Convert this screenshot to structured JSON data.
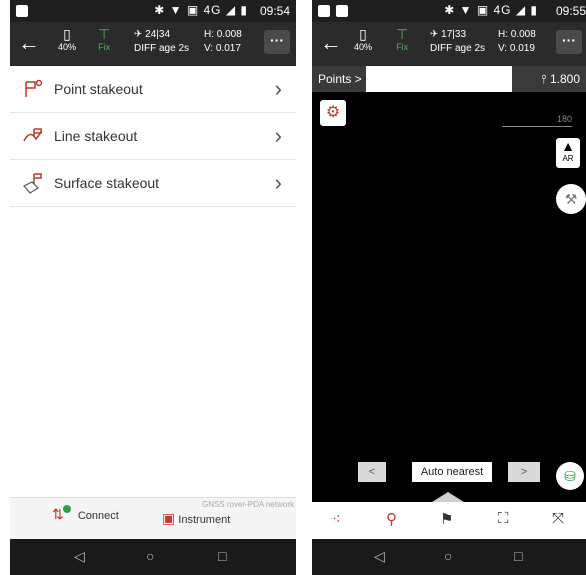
{
  "left": {
    "status": {
      "icons": "✱ ▼ ▣ 4G ◢ ▮",
      "time": "09:54"
    },
    "header": {
      "battery": "40%",
      "fix": "Fix",
      "sats": "24|34",
      "diff": "DIFF age 2s",
      "h": "H: 0.008",
      "v": "V: 0.017"
    },
    "menu": [
      {
        "label": "Point stakeout"
      },
      {
        "label": "Line stakeout"
      },
      {
        "label": "Surface stakeout"
      }
    ],
    "bottom": {
      "connect": "Connect",
      "instrument": "Instrument",
      "note": "GNSS rover-PDA network"
    }
  },
  "right": {
    "status": {
      "icons": "✱ ▼ ▣ 4G ◢ ▮",
      "time": "09:55"
    },
    "header": {
      "battery": "40%",
      "fix": "Fix",
      "sats": "17|33",
      "diff": "DIFF age 2s",
      "h": "H: 0.008",
      "v": "V: 0.019"
    },
    "toolbar": {
      "points": "Points >",
      "height": "1.800"
    },
    "scale": "180",
    "ar": "AR",
    "nav": {
      "prev": "<",
      "mode": "Auto nearest",
      "next": ">"
    }
  },
  "colors": {
    "accent_red": "#c0392b",
    "fix_green": "#4caf50",
    "header_bg": "#2b2b2b"
  }
}
